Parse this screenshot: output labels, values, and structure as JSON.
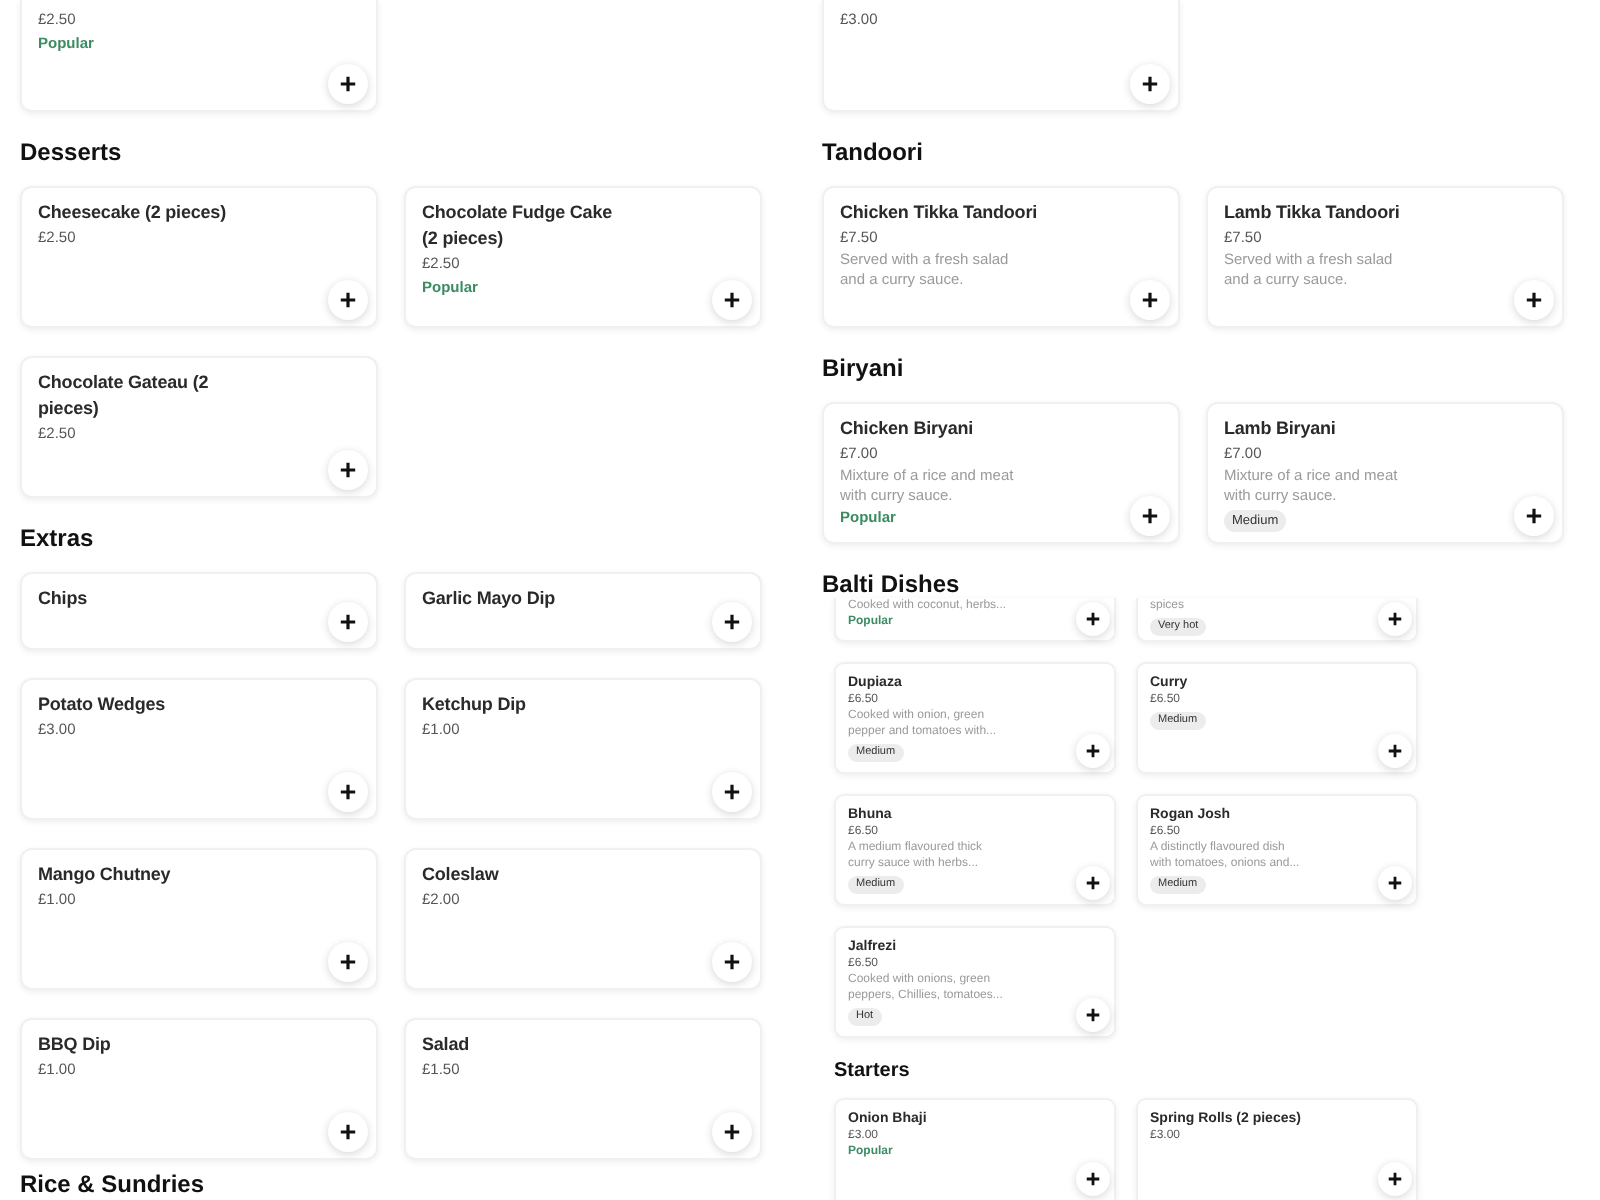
{
  "left_column": {
    "continued_items": [
      {
        "price": "£2.50",
        "tags": [
          {
            "kind": "popular",
            "label": "Popular"
          }
        ]
      }
    ],
    "sections": [
      {
        "heading": "Desserts",
        "items": [
          {
            "name": "Cheesecake (2 pieces)",
            "price": "£2.50"
          },
          {
            "name": "Chocolate Fudge Cake (2 pieces)",
            "price": "£2.50",
            "tags": [
              {
                "kind": "popular",
                "label": "Popular"
              }
            ]
          },
          {
            "name": "Chocolate Gateau (2 pieces)",
            "price": "£2.50"
          }
        ]
      },
      {
        "heading": "Extras",
        "items": [
          {
            "name": "Chips"
          },
          {
            "name": "Garlic Mayo Dip"
          },
          {
            "name": "Potato Wedges",
            "price": "£3.00"
          },
          {
            "name": "Ketchup Dip",
            "price": "£1.00"
          },
          {
            "name": "Mango Chutney",
            "price": "£1.00"
          },
          {
            "name": "Coleslaw",
            "price": "£2.00"
          },
          {
            "name": "BBQ Dip",
            "price": "£1.00"
          },
          {
            "name": "Salad",
            "price": "£1.50"
          }
        ]
      }
    ],
    "next_heading": "Rice & Sundries"
  },
  "right_column": {
    "continued_items": [
      {
        "price": "£3.00"
      }
    ],
    "sections": [
      {
        "heading": "Tandoori",
        "items": [
          {
            "name": "Chicken Tikka Tandoori",
            "price": "£7.50",
            "description": "Served with a fresh salad and a curry sauce."
          },
          {
            "name": "Lamb Tikka Tandoori",
            "price": "£7.50",
            "description": "Served with a fresh salad and a curry sauce."
          }
        ]
      },
      {
        "heading": "Biryani",
        "items": [
          {
            "name": "Chicken Biryani",
            "price": "£7.00",
            "description": "Mixture of a rice and meat with curry sauce.",
            "tags": [
              {
                "kind": "popular",
                "label": "Popular"
              }
            ]
          },
          {
            "name": "Lamb Biryani",
            "price": "£7.00",
            "description": "Mixture of a rice and meat with curry sauce.",
            "tags": [
              {
                "kind": "spice",
                "label": "Medium"
              }
            ]
          }
        ]
      }
    ],
    "balti_dishes": {
      "heading": "Balti Dishes",
      "continued_items": [
        {
          "description": "Cooked with coconut, herbs...",
          "tags": [
            {
              "kind": "popular",
              "label": "Popular"
            }
          ]
        },
        {
          "description": "spices",
          "tags": [
            {
              "kind": "spice",
              "label": "Very hot"
            }
          ]
        }
      ],
      "items": [
        {
          "name": "Dupiaza",
          "price": "£6.50",
          "description": "Cooked with onion, green pepper and tomatoes with...",
          "tags": [
            {
              "kind": "spice",
              "label": "Medium"
            }
          ]
        },
        {
          "name": "Curry",
          "price": "£6.50",
          "tags": [
            {
              "kind": "spice",
              "label": "Medium"
            }
          ]
        },
        {
          "name": "Bhuna",
          "price": "£6.50",
          "description": "A medium flavoured thick curry sauce with herbs...",
          "tags": [
            {
              "kind": "spice",
              "label": "Medium"
            }
          ]
        },
        {
          "name": "Rogan Josh",
          "price": "£6.50",
          "description": "A distinctly flavoured dish with tomatoes, onions and...",
          "tags": [
            {
              "kind": "spice",
              "label": "Medium"
            }
          ]
        },
        {
          "name": "Jalfrezi",
          "price": "£6.50",
          "description": "Cooked with onions, green peppers, Chillies, tomatoes...",
          "tags": [
            {
              "kind": "spice",
              "label": "Hot"
            }
          ]
        }
      ],
      "starters": {
        "heading": "Starters",
        "items": [
          {
            "name": "Onion Bhaji",
            "price": "£3.00",
            "tags": [
              {
                "kind": "popular",
                "label": "Popular"
              }
            ]
          },
          {
            "name": "Spring Rolls (2 pieces)",
            "price": "£3.00"
          }
        ]
      }
    }
  }
}
